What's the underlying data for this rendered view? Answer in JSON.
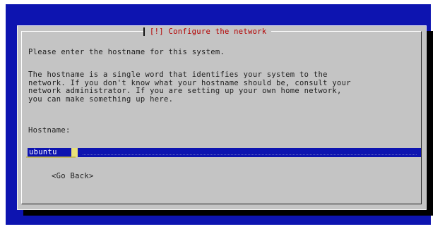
{
  "dialog": {
    "title": "[!] Configure the network",
    "question": "Please enter the hostname for this system.",
    "description": [
      "The hostname is a single word that identifies your system to the",
      "network. If you don't know what your hostname should be, consult your",
      "network administrator. If you are setting up your own home network,",
      "you can make something up here."
    ],
    "field_label": "Hostname:",
    "hostname_value": "ubuntu",
    "back_button": "<Go Back>"
  },
  "colors": {
    "background": "#0d14b0",
    "dialog": "#c4c4c4",
    "title": "#b30000",
    "input": "#0d14b0",
    "cursor": "#e8e07a"
  }
}
